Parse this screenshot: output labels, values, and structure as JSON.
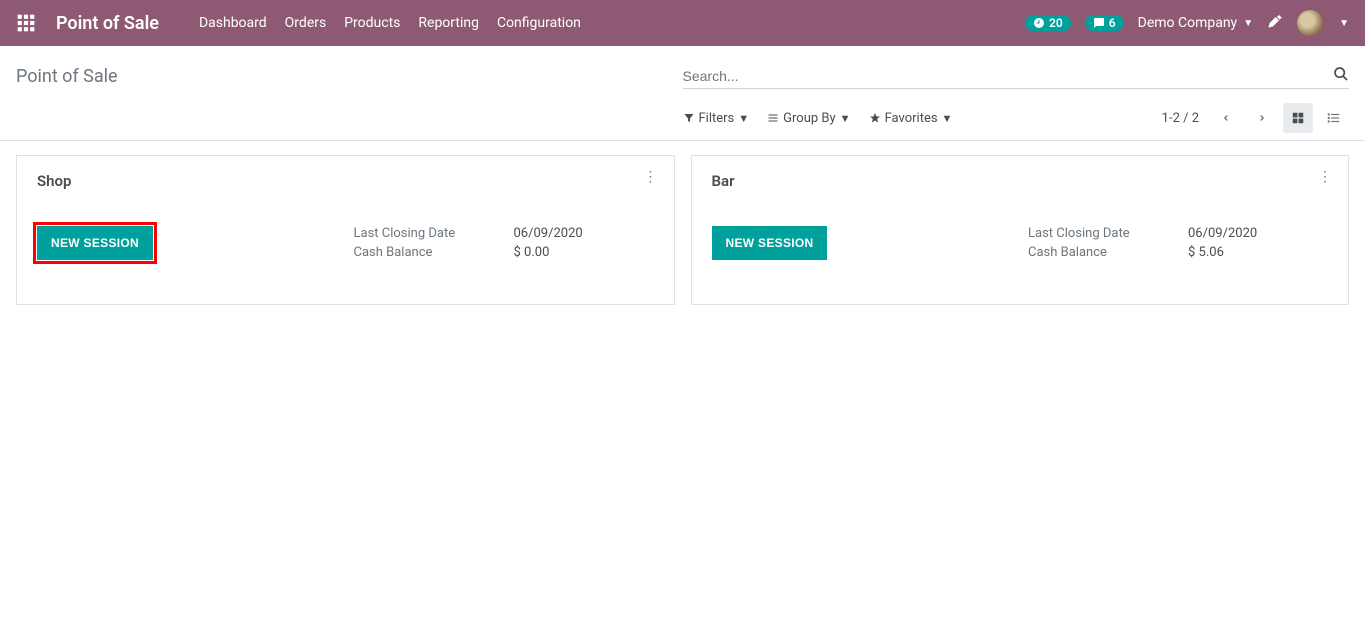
{
  "navbar": {
    "app_title": "Point of Sale",
    "items": [
      "Dashboard",
      "Orders",
      "Products",
      "Reporting",
      "Configuration"
    ],
    "activity_count": "20",
    "messages_count": "6",
    "company": "Demo Company"
  },
  "control_panel": {
    "breadcrumb": "Point of Sale",
    "search_placeholder": "Search...",
    "filters_label": "Filters",
    "groupby_label": "Group By",
    "favorites_label": "Favorites",
    "pager": "1-2 / 2"
  },
  "cards": [
    {
      "title": "Shop",
      "button_label": "NEW SESSION",
      "highlighted": true,
      "last_closing_label": "Last Closing Date",
      "last_closing_value": "06/09/2020",
      "cash_balance_label": "Cash Balance",
      "cash_balance_value": "$ 0.00"
    },
    {
      "title": "Bar",
      "button_label": "NEW SESSION",
      "highlighted": false,
      "last_closing_label": "Last Closing Date",
      "last_closing_value": "06/09/2020",
      "cash_balance_label": "Cash Balance",
      "cash_balance_value": "$ 5.06"
    }
  ]
}
